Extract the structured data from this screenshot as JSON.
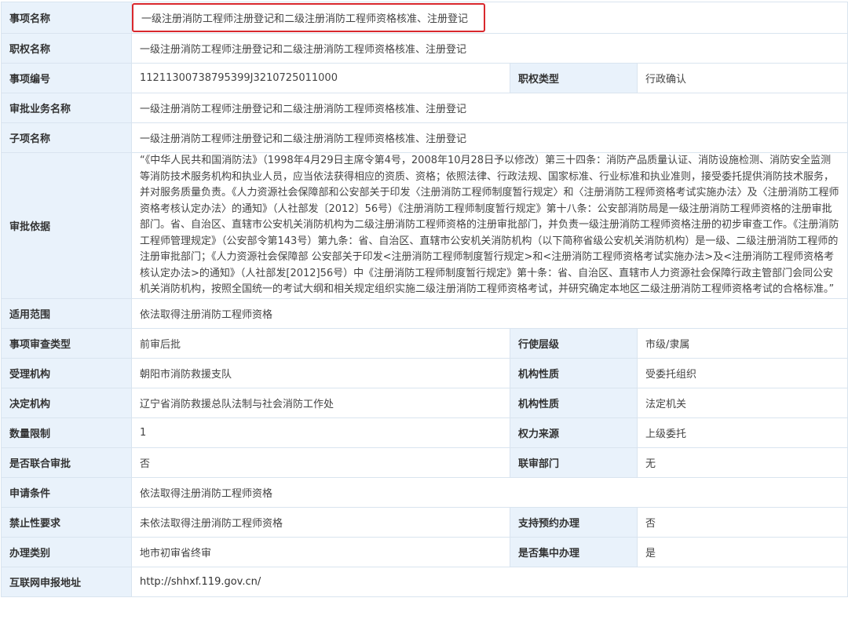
{
  "rows": {
    "item_name": {
      "label": "事项名称",
      "value": "一级注册消防工程师注册登记和二级注册消防工程师资格核准、注册登记"
    },
    "power_name": {
      "label": "职权名称",
      "value": "一级注册消防工程师注册登记和二级注册消防工程师资格核准、注册登记"
    },
    "item_code": {
      "label": "事项编号",
      "value": "11211300738795399J3210725011000",
      "label2": "职权类型",
      "value2": "行政确认"
    },
    "business_name": {
      "label": "审批业务名称",
      "value": "一级注册消防工程师注册登记和二级注册消防工程师资格核准、注册登记"
    },
    "sub_item": {
      "label": "子项名称",
      "value": "一级注册消防工程师注册登记和二级注册消防工程师资格核准、注册登记"
    },
    "basis": {
      "label": "审批依据",
      "value": "“《中华人民共和国消防法》（1998年4月29日主席令第4号，2008年10月28日予以修改）第三十四条：消防产品质量认证、消防设施检测、消防安全监测等消防技术服务机构和执业人员，应当依法获得相应的资质、资格；依照法律、行政法规、国家标准、行业标准和执业准则，接受委托提供消防技术服务，并对服务质量负责。《人力资源社会保障部和公安部关于印发〈注册消防工程师制度暂行规定〉和〈注册消防工程师资格考试实施办法〉及〈注册消防工程师资格考核认定办法〉的通知》（人社部发〔2012〕56号）《注册消防工程师制度暂行规定》第十八条：公安部消防局是一级注册消防工程师资格的注册审批部门。省、自治区、直辖市公安机关消防机构为二级注册消防工程师资格的注册审批部门，并负责一级注册消防工程师资格注册的初步审查工作。《注册消防工程师管理规定》（公安部令第143号）第九条：省、自治区、直辖市公安机关消防机构（以下简称省级公安机关消防机构）是一级、二级注册消防工程师的注册审批部门；《人力资源社会保障部 公安部关于印发<注册消防工程师制度暂行规定>和<注册消防工程师资格考试实施办法>及<注册消防工程师资格考核认定办法>的通知》（人社部发[2012]56号）中《注册消防工程师制度暂行规定》第十条：省、自治区、直辖市人力资源社会保障行政主管部门会同公安机关消防机构，按照全国统一的考试大纲和相关规定组织实施二级注册消防工程师资格考试，并研究确定本地区二级注册消防工程师资格考试的合格标准。”"
    },
    "scope": {
      "label": "适用范围",
      "value": "依法取得注册消防工程师资格"
    },
    "review_type": {
      "label": "事项审查类型",
      "value": "前审后批",
      "label2": "行使层级",
      "value2": "市级/隶属"
    },
    "accept_org": {
      "label": "受理机构",
      "value": "朝阳市消防救援支队",
      "label2": "机构性质",
      "value2": "受委托组织"
    },
    "decide_org": {
      "label": "决定机构",
      "value": "辽宁省消防救援总队法制与社会消防工作处",
      "label2": "机构性质",
      "value2": "法定机关"
    },
    "quantity": {
      "label": "数量限制",
      "value": "1",
      "label2": "权力来源",
      "value2": "上级委托"
    },
    "joint": {
      "label": "是否联合审批",
      "value": "否",
      "label2": "联审部门",
      "value2": "无"
    },
    "conditions": {
      "label": "申请条件",
      "value": "依法取得注册消防工程师资格"
    },
    "prohibit": {
      "label": "禁止性要求",
      "value": "未依法取得注册消防工程师资格",
      "label2": "支持预约办理",
      "value2": "否"
    },
    "category": {
      "label": "办理类别",
      "value": "地市初审省终审",
      "label2": "是否集中办理",
      "value2": "是"
    },
    "online": {
      "label": "互联网申报地址",
      "value": "http://shhxf.119.gov.cn/"
    }
  },
  "colors": {
    "label_bg": "#e9f2fb",
    "border": "#d9e4ef",
    "highlight": "#d9282d"
  }
}
